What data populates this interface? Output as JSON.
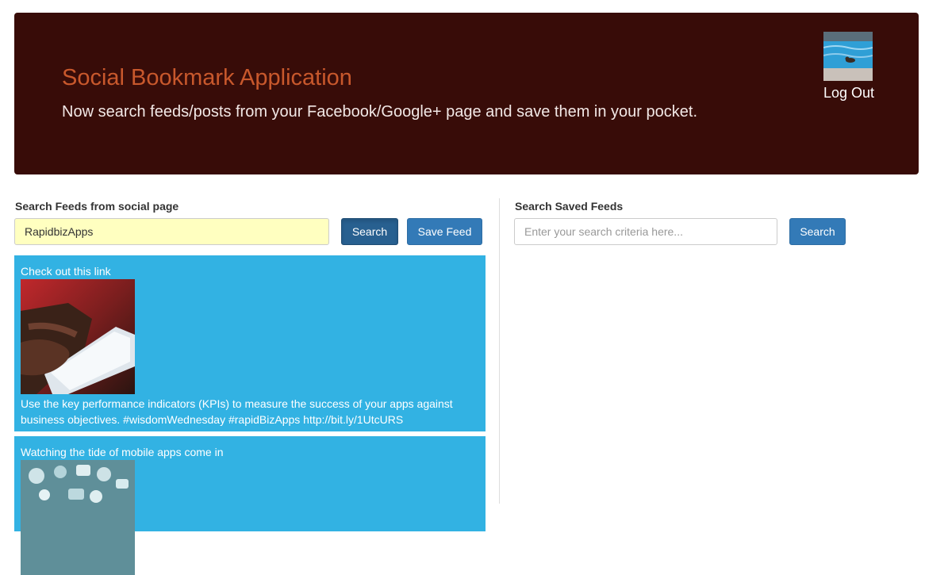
{
  "header": {
    "title": "Social Bookmark Application",
    "subtitle": "Now search feeds/posts from your Facebook/Google+ page and save them in your pocket.",
    "logout_label": "Log Out"
  },
  "left_panel": {
    "label": "Search Feeds from social page",
    "search_value": "RapidbizApps",
    "search_button": "Search",
    "save_button": "Save Feed"
  },
  "right_panel": {
    "label": "Search Saved Feeds",
    "search_placeholder": "Enter your search criteria here...",
    "search_button": "Search"
  },
  "feeds": [
    {
      "title": "Check out this link",
      "text": "Use the key performance indicators (KPIs) to measure the success of your apps against business objectives. #wisdomWednesday #rapidBizApps http://bit.ly/1UtcURS"
    },
    {
      "title": "Watching the tide of mobile apps come in",
      "text": ""
    }
  ],
  "colors": {
    "banner_bg": "#380c08",
    "title_color": "#c8582c",
    "feed_bg": "#32b2e3",
    "button_primary": "#337ab7"
  }
}
